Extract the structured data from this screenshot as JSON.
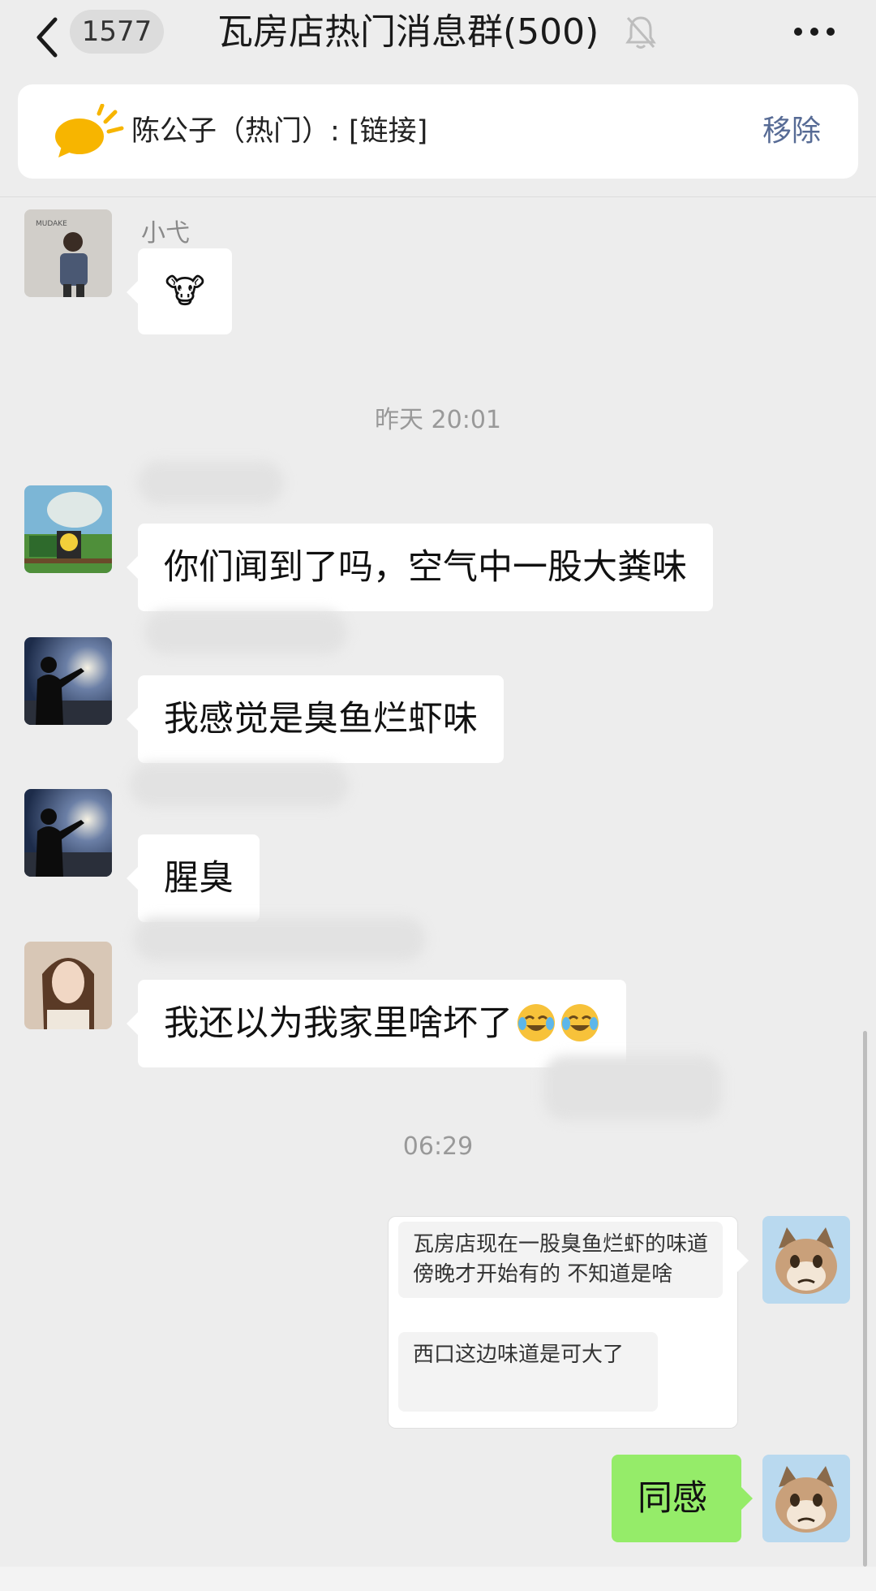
{
  "header": {
    "unread_count": "1577",
    "title": "瓦房店热门消息群(500)"
  },
  "pinned": {
    "text": "陈公子（热门）: [链接]",
    "remove_label": "移除"
  },
  "messages": {
    "m1": {
      "nick": "小弋",
      "emoji": "🐮"
    },
    "time1": "昨天 20:01",
    "m2": {
      "text": "你们闻到了吗，空气中一股大粪味"
    },
    "m3": {
      "text": "我感觉是臭鱼烂虾味"
    },
    "m4": {
      "text": "腥臭"
    },
    "m5": {
      "text": "我还以为我家里啥坏了"
    },
    "time2": "06:29",
    "m6": {
      "quote1": "瓦房店现在一股臭鱼烂虾的味道 傍晚才开始有的 不知道是啥",
      "quote2": "西口这边味道是可大了"
    },
    "m7": {
      "text": "同感"
    }
  },
  "colors": {
    "background": "#ededed",
    "my_bubble": "#95ec69",
    "link_blue": "#576b95"
  }
}
